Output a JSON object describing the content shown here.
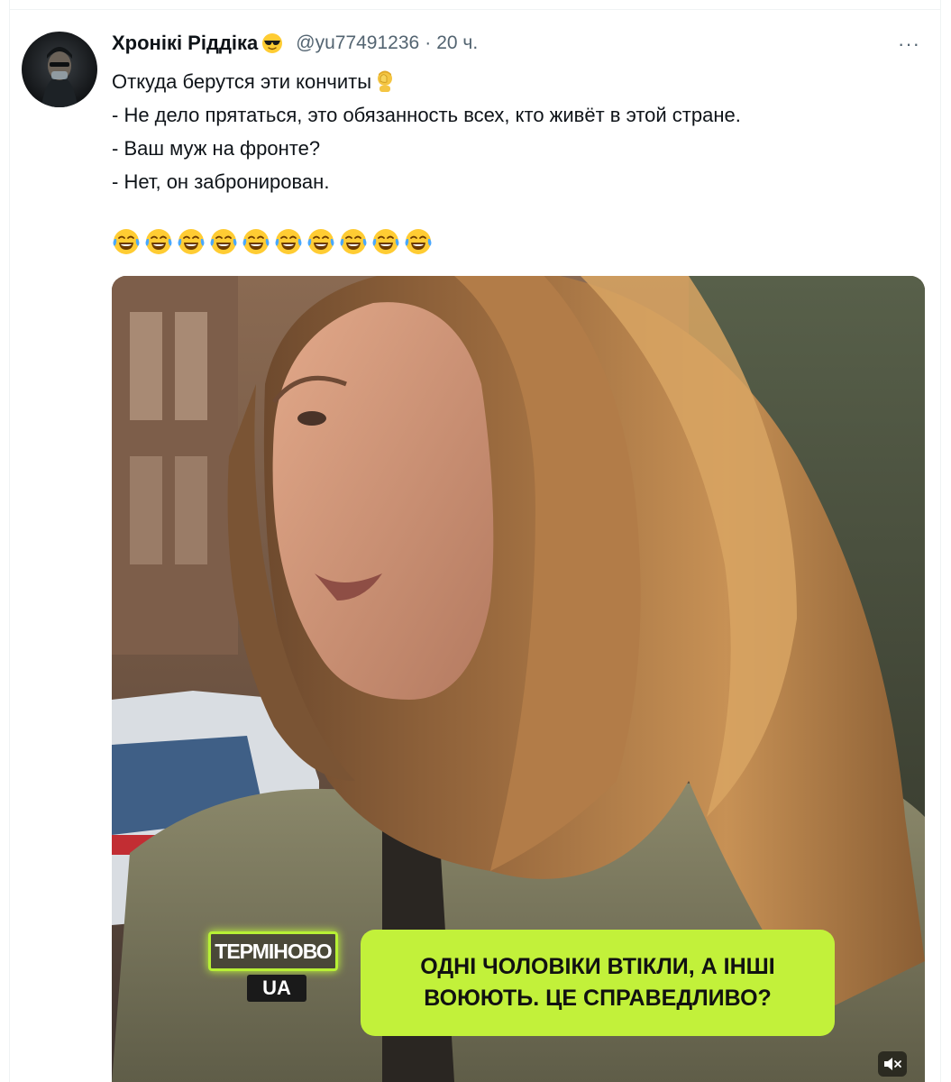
{
  "tweet": {
    "author": {
      "display_name": "Хронікі Ріддіка",
      "name_emoji": "smiling-face-with-sunglasses",
      "handle": "@yu77491236",
      "timestamp": "20 ч."
    },
    "more_menu": "···",
    "text_lines": [
      "Откуда берутся эти кончиты",
      "- Не дело прятаться, это обязанность всех, кто живёт в этой стране.",
      "- Ваш муж на фронте?",
      "- Нет, он забронирован."
    ],
    "first_line_emoji": "person-facepalming",
    "laugh_emoji_count": 10,
    "laugh_emoji": "face-with-tears-of-joy"
  },
  "media": {
    "logo_top": "ТЕРМІНОВО",
    "logo_bottom": "UA",
    "caption_lines": [
      "ОДНІ ЧОЛОВІКИ ВТІКЛИ, А ІНШІ",
      "ВОЮЮТЬ. ЦЕ СПРАВЕДЛИВО?"
    ],
    "mute_icon": "speaker-muted-icon"
  },
  "colors": {
    "caption_bg": "#c2f13a",
    "secondary_text": "#536471",
    "primary_text": "#0f1419"
  }
}
